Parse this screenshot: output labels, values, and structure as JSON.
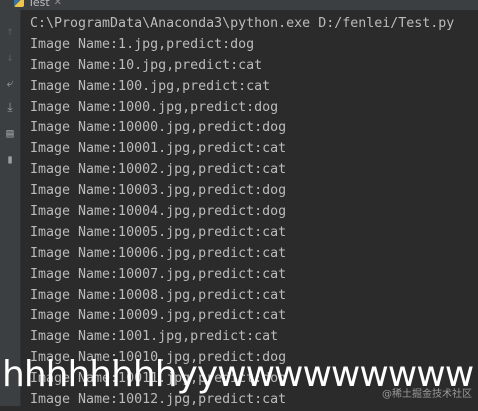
{
  "tab": {
    "title": "Test",
    "close_glyph": "✕",
    "icon": "python-icon"
  },
  "gutter": {
    "icons": [
      "up-arrow-icon",
      "down-arrow-icon",
      "soft-wrap-icon",
      "scroll-to-end-icon",
      "print-icon",
      "trash-icon"
    ]
  },
  "console": {
    "lines": [
      "C:\\ProgramData\\Anaconda3\\python.exe D:/fenlei/Test.py",
      "Image Name:1.jpg,predict:dog",
      "Image Name:10.jpg,predict:cat",
      "Image Name:100.jpg,predict:cat",
      "Image Name:1000.jpg,predict:dog",
      "Image Name:10000.jpg,predict:dog",
      "Image Name:10001.jpg,predict:cat",
      "Image Name:10002.jpg,predict:cat",
      "Image Name:10003.jpg,predict:dog",
      "Image Name:10004.jpg,predict:dog",
      "Image Name:10005.jpg,predict:cat",
      "Image Name:10006.jpg,predict:cat",
      "Image Name:10007.jpg,predict:cat",
      "Image Name:10008.jpg,predict:cat",
      "Image Name:10009.jpg,predict:cat",
      "Image Name:1001.jpg,predict:cat",
      "Image Name:10010.jpg,predict:dog",
      "Image Name:10011.jpg,predict:dog",
      "Image Name:10012.jpg,predict:cat"
    ]
  },
  "overlay_text": "hhhhhhhhyywwwwwwwww",
  "watermark": "@稀土掘金技术社区",
  "colors": {
    "background": "#2b2b2b",
    "gutter": "#3c3f41",
    "text": "#bbbbbb"
  }
}
